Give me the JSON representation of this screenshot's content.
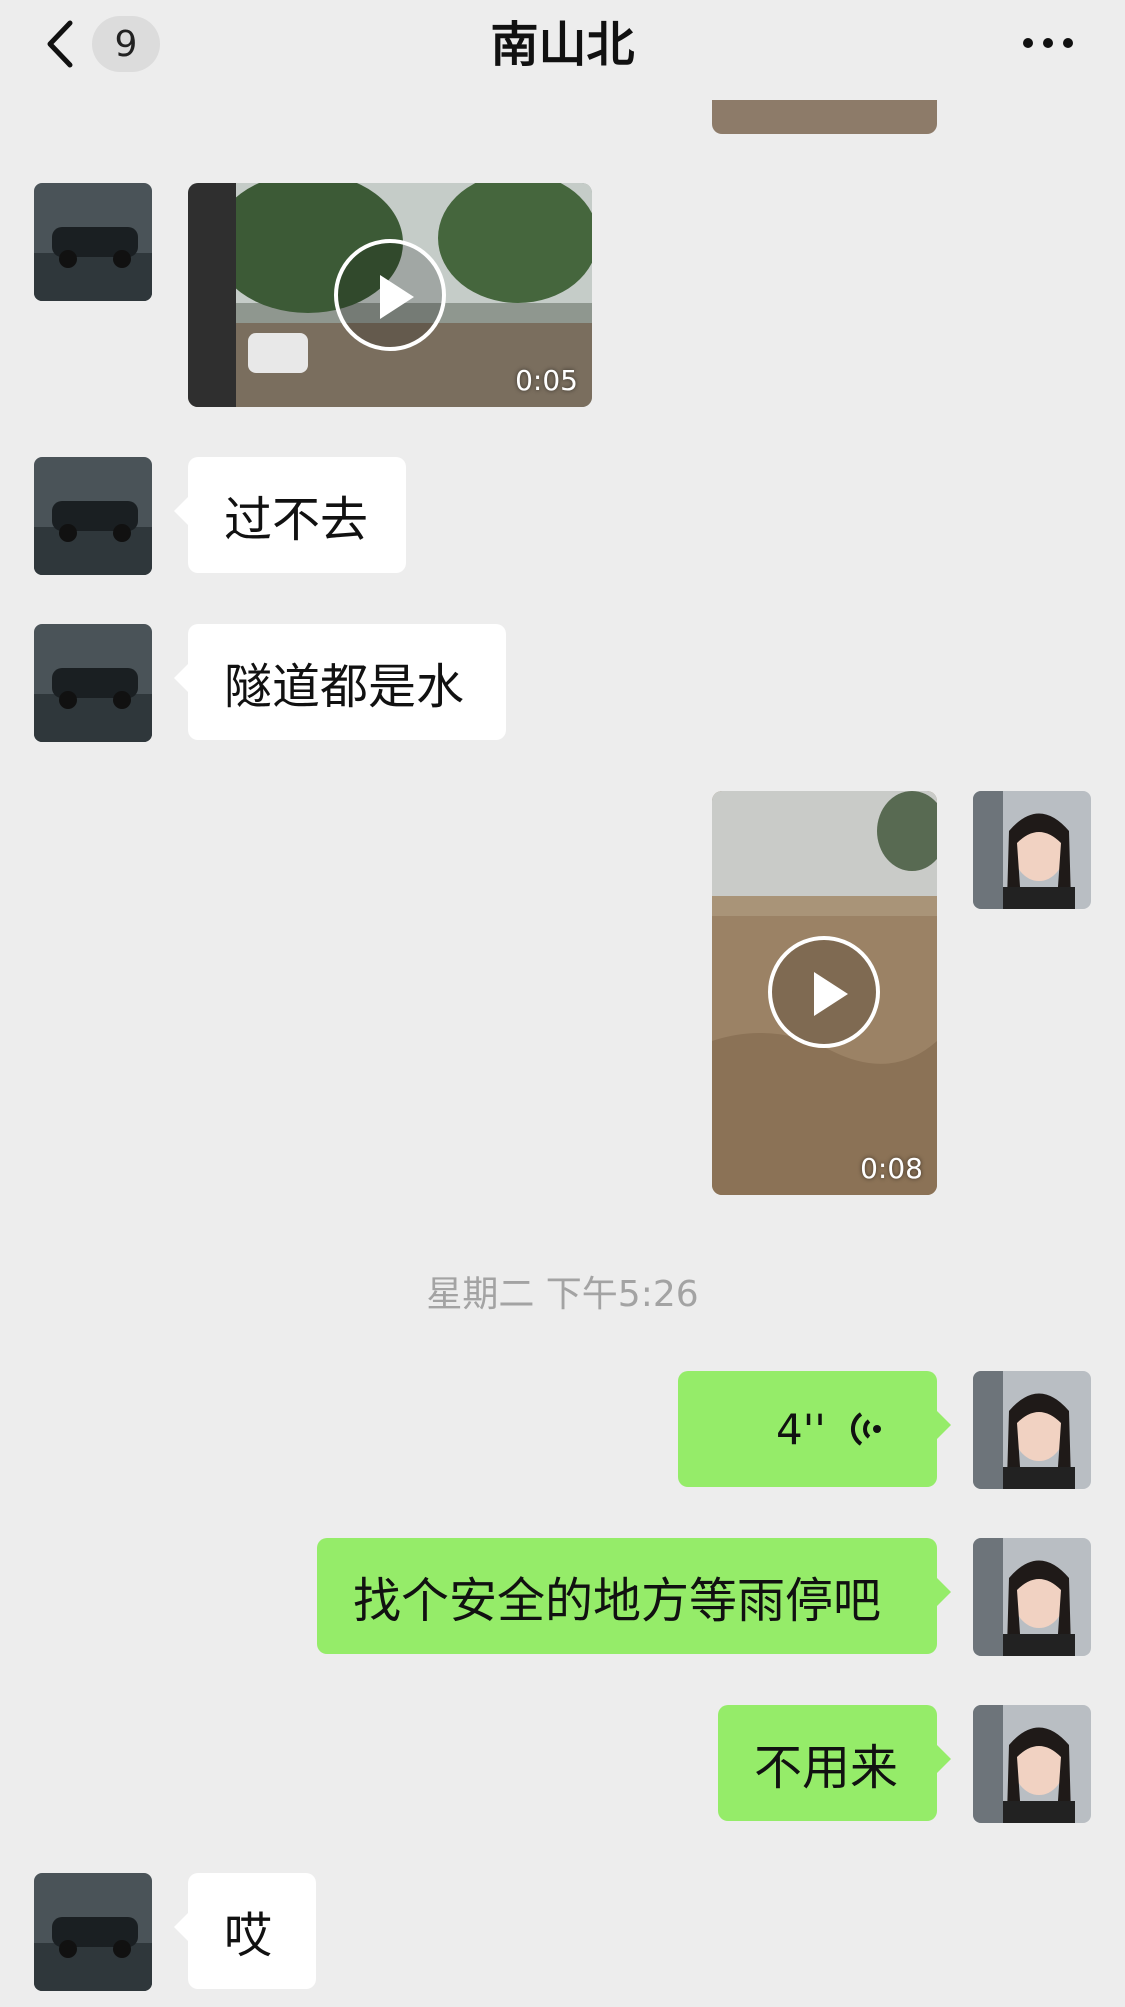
{
  "header": {
    "unread_count": "9",
    "title": "南山北"
  },
  "messages": [
    {
      "side": "left",
      "type": "video",
      "duration": "0:05"
    },
    {
      "side": "left",
      "type": "text",
      "text": "过不去"
    },
    {
      "side": "left",
      "type": "text",
      "text": "隧道都是水"
    },
    {
      "side": "right",
      "type": "video",
      "duration": "0:08"
    },
    {
      "side": "right",
      "type": "voice",
      "length": "4''"
    },
    {
      "side": "right",
      "type": "text",
      "text": "找个安全的地方等雨停吧"
    },
    {
      "side": "right",
      "type": "text",
      "text": "不用来"
    },
    {
      "side": "left",
      "type": "text",
      "text": "哎"
    }
  ],
  "timestamp": "星期二 下午5:26",
  "colors": {
    "background": "#ededed",
    "incoming_bubble": "#ffffff",
    "outgoing_bubble": "#95ec69",
    "timestamp_text": "#a3a3a3"
  }
}
